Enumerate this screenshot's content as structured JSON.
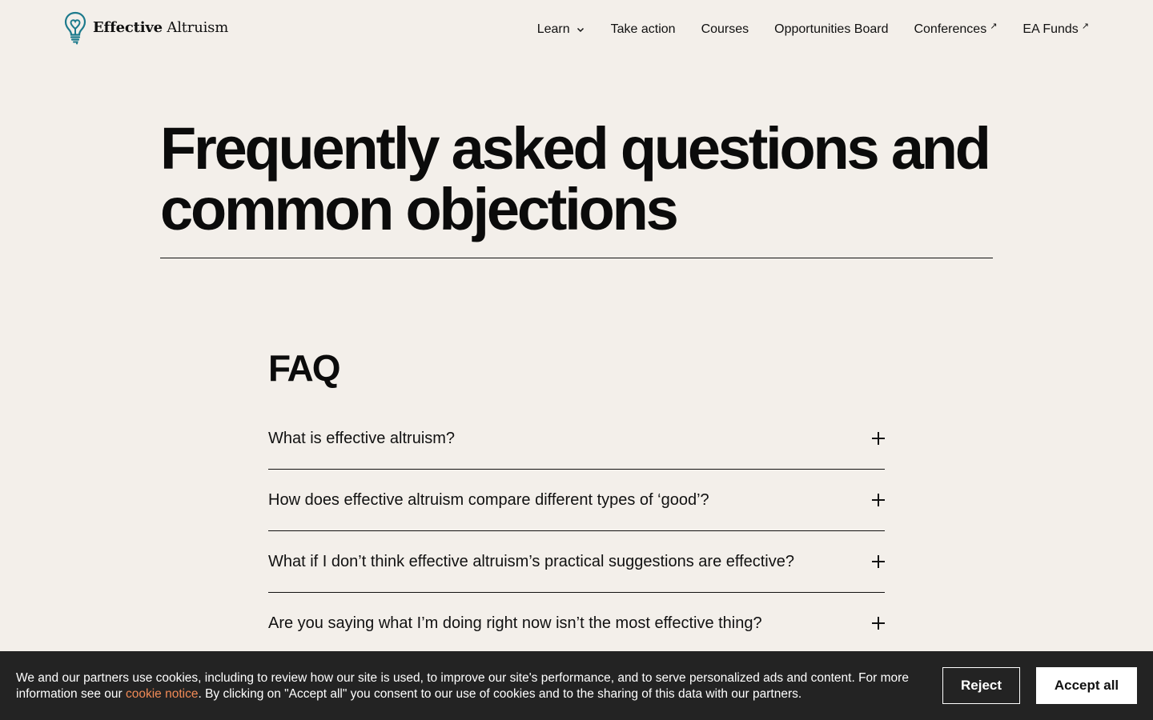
{
  "header": {
    "logo": {
      "icon": "lightbulb-heart-icon",
      "bold_word": "Effective",
      "word": "Altruism",
      "color": "#1c7a8c"
    },
    "nav": [
      {
        "label": "Learn",
        "icon": "chevron-down-icon"
      },
      {
        "label": "Take action"
      },
      {
        "label": "Courses"
      },
      {
        "label": "Opportunities Board"
      },
      {
        "label": "Conferences",
        "icon": "external-link-icon",
        "glyph": "↗"
      },
      {
        "label": "EA Funds",
        "icon": "external-link-icon",
        "glyph": "↗"
      }
    ]
  },
  "hero": {
    "title": "Frequently asked questions and common objections"
  },
  "faq": {
    "title": "FAQ",
    "items": [
      {
        "question": "What is effective altruism?",
        "icon": "plus-icon"
      },
      {
        "question": "How does effective altruism compare different types of ‘good’?",
        "icon": "plus-icon"
      },
      {
        "question": "What if I don’t think effective altruism’s practical suggestions are effective?",
        "icon": "plus-icon"
      },
      {
        "question": "Are you saying what I’m doing right now isn’t the most effective thing?",
        "icon": "plus-icon"
      }
    ]
  },
  "cookie_banner": {
    "text_before": "We and our partners use cookies, including to review how our site is used, to improve our site's performance, and to serve personalized ads and content. For more information see our ",
    "link_label": "cookie notice",
    "text_after": ". By clicking on \"Accept all\" you consent to our use of cookies and to the sharing of this data with our partners.",
    "reject_label": "Reject",
    "accept_label": "Accept all",
    "link_color": "#f08a56",
    "background": "#232323"
  }
}
